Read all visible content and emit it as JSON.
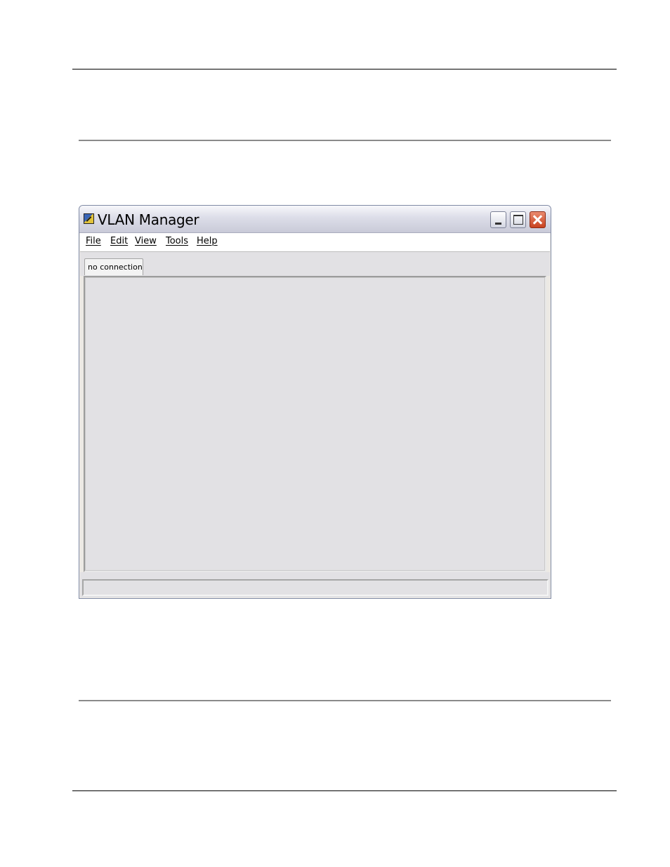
{
  "window": {
    "title": "VLAN Manager",
    "icon": "vlan-manager-app-icon",
    "controls": {
      "minimize_icon": "minimize-icon",
      "maximize_icon": "maximize-icon",
      "close_icon": "close-icon"
    }
  },
  "menubar": {
    "items": [
      {
        "label": "File"
      },
      {
        "label": "Edit"
      },
      {
        "label": "View"
      },
      {
        "label": "Tools"
      },
      {
        "label": "Help"
      }
    ]
  },
  "tabs": [
    {
      "label": "no connection",
      "selected": true
    }
  ],
  "statusbar": {
    "text": ""
  },
  "colors": {
    "close_button": "#c9421f",
    "panel_background": "#e2e1e4",
    "menubar_background": "#ffffff"
  }
}
